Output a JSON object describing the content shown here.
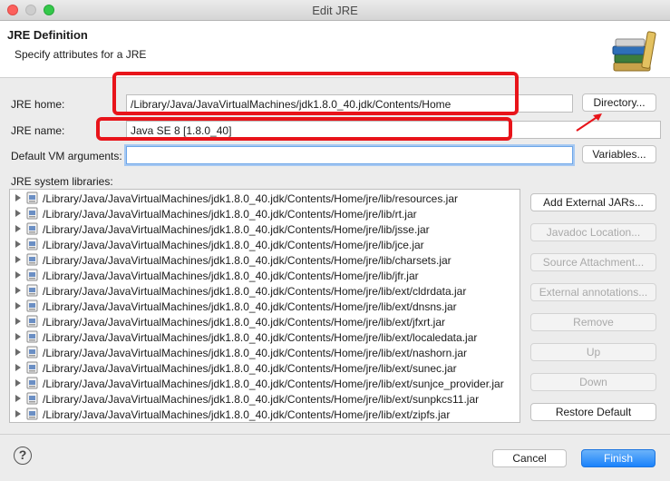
{
  "window": {
    "title": "Edit JRE"
  },
  "header": {
    "title": "JRE Definition",
    "subtitle": "Specify attributes for a JRE",
    "icon": "library-books-icon"
  },
  "form": {
    "jre_home_label": "JRE home:",
    "jre_home_value": "/Library/Java/JavaVirtualMachines/jdk1.8.0_40.jdk/Contents/Home",
    "directory_button": "Directory...",
    "jre_name_label": "JRE name:",
    "jre_name_value": "Java SE 8 [1.8.0_40]",
    "vm_args_label": "Default VM arguments:",
    "vm_args_value": "",
    "variables_button": "Variables..."
  },
  "libraries": {
    "label": "JRE system libraries:",
    "items": [
      "/Library/Java/JavaVirtualMachines/jdk1.8.0_40.jdk/Contents/Home/jre/lib/resources.jar",
      "/Library/Java/JavaVirtualMachines/jdk1.8.0_40.jdk/Contents/Home/jre/lib/rt.jar",
      "/Library/Java/JavaVirtualMachines/jdk1.8.0_40.jdk/Contents/Home/jre/lib/jsse.jar",
      "/Library/Java/JavaVirtualMachines/jdk1.8.0_40.jdk/Contents/Home/jre/lib/jce.jar",
      "/Library/Java/JavaVirtualMachines/jdk1.8.0_40.jdk/Contents/Home/jre/lib/charsets.jar",
      "/Library/Java/JavaVirtualMachines/jdk1.8.0_40.jdk/Contents/Home/jre/lib/jfr.jar",
      "/Library/Java/JavaVirtualMachines/jdk1.8.0_40.jdk/Contents/Home/jre/lib/ext/cldrdata.jar",
      "/Library/Java/JavaVirtualMachines/jdk1.8.0_40.jdk/Contents/Home/jre/lib/ext/dnsns.jar",
      "/Library/Java/JavaVirtualMachines/jdk1.8.0_40.jdk/Contents/Home/jre/lib/ext/jfxrt.jar",
      "/Library/Java/JavaVirtualMachines/jdk1.8.0_40.jdk/Contents/Home/jre/lib/ext/localedata.jar",
      "/Library/Java/JavaVirtualMachines/jdk1.8.0_40.jdk/Contents/Home/jre/lib/ext/nashorn.jar",
      "/Library/Java/JavaVirtualMachines/jdk1.8.0_40.jdk/Contents/Home/jre/lib/ext/sunec.jar",
      "/Library/Java/JavaVirtualMachines/jdk1.8.0_40.jdk/Contents/Home/jre/lib/ext/sunjce_provider.jar",
      "/Library/Java/JavaVirtualMachines/jdk1.8.0_40.jdk/Contents/Home/jre/lib/ext/sunpkcs11.jar",
      "/Library/Java/JavaVirtualMachines/jdk1.8.0_40.jdk/Contents/Home/jre/lib/ext/zipfs.jar"
    ]
  },
  "side_buttons": {
    "add_external": "Add External JARs...",
    "javadoc": "Javadoc Location...",
    "source": "Source Attachment...",
    "external_annotations": "External annotations...",
    "remove": "Remove",
    "up": "Up",
    "down": "Down",
    "restore": "Restore Default"
  },
  "footer": {
    "help": "?",
    "cancel": "Cancel",
    "finish": "Finish"
  },
  "colors": {
    "annotation_red": "#e8141a",
    "accent": "#1a82fb"
  }
}
